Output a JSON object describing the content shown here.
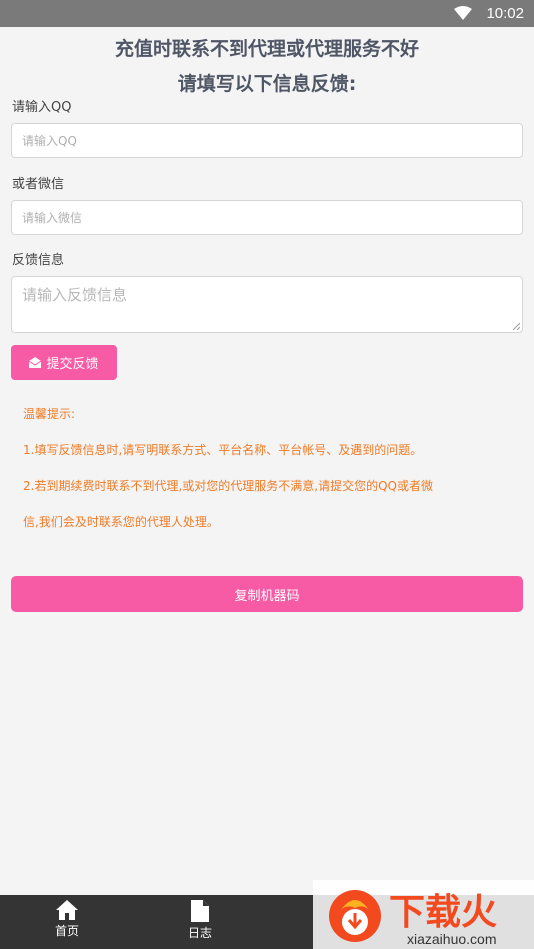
{
  "status_bar": {
    "time": "10:02",
    "wifi_icon": "wifi-icon"
  },
  "header": {
    "title_line1": "充值时联系不到代理或代理服务不好",
    "title_line2": "请填写以下信息反馈:"
  },
  "form": {
    "qq_label": "请输入QQ",
    "qq_placeholder": "请输入QQ",
    "wechat_label": "或者微信",
    "wechat_placeholder": "请输入微信",
    "feedback_label": "反馈信息",
    "feedback_placeholder": "请输入反馈信息",
    "submit_label": "提交反馈",
    "submit_icon": "envelope-open-icon"
  },
  "tips": {
    "title": "温馨提示:",
    "line1": "1.填写反馈信息时,请写明联系方式、平台名称、平台帐号、及遇到的问题。",
    "line2": "2.若到期续费时联系不到代理,或对您的代理服务不满意,请提交您的QQ或者微",
    "line3": "信,我们会及时联系您的代理人处理。"
  },
  "copy_button": {
    "label": "复制机器码"
  },
  "tab_bar": {
    "tabs": [
      {
        "label": "首页",
        "icon": "home-icon"
      },
      {
        "label": "日志",
        "icon": "document-icon"
      }
    ]
  },
  "watermark": {
    "brand": "下载火",
    "url": "xiazaihuo.com"
  },
  "colors": {
    "accent": "#f75ba5",
    "tip": "#ef7b27",
    "title": "#4f5666"
  }
}
